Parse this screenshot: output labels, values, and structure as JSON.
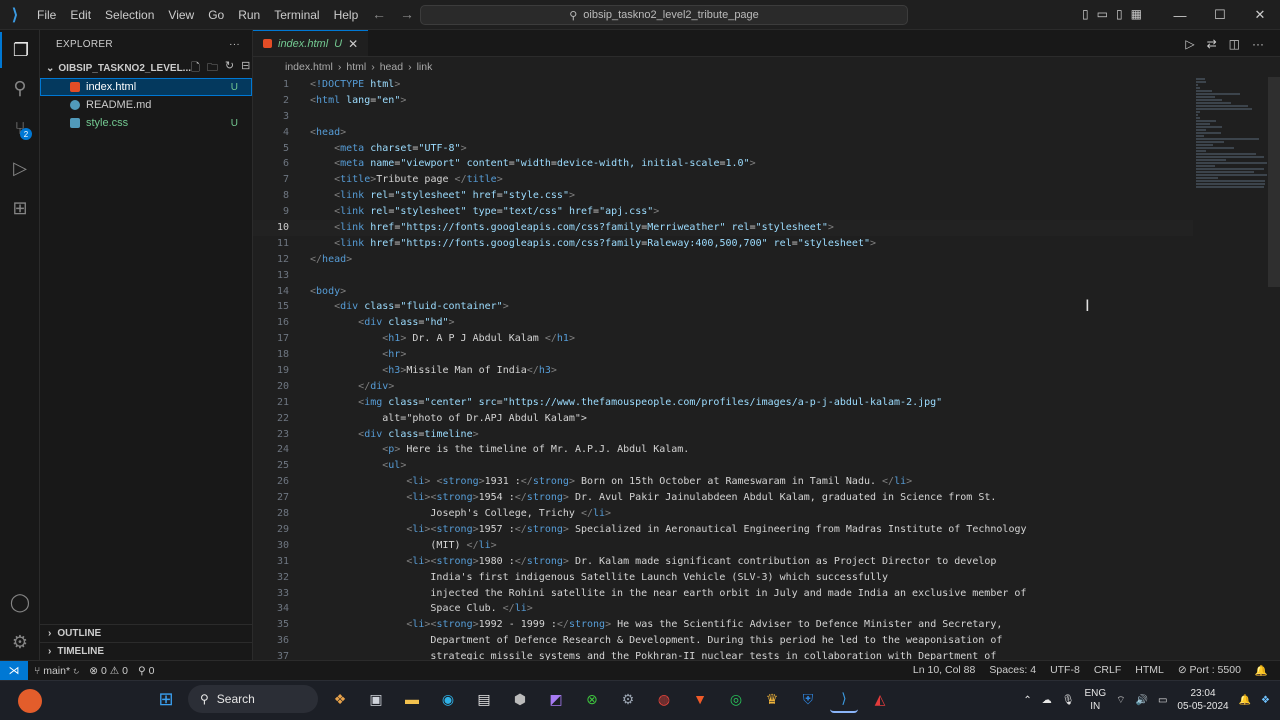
{
  "titlebar": {
    "menu": [
      "File",
      "Edit",
      "Selection",
      "View",
      "Go",
      "Run",
      "Terminal",
      "Help"
    ],
    "search_text": "oibsip_taskno2_level2_tribute_page"
  },
  "sidebar": {
    "title": "EXPLORER",
    "folder": "OIBSIP_TASKNO2_LEVEL...",
    "files": [
      {
        "name": "index.html",
        "status": "U",
        "icon_color": "#e44d26"
      },
      {
        "name": "README.md",
        "status": "",
        "icon_color": "#519aba"
      },
      {
        "name": "style.css",
        "status": "U",
        "icon_color": "#519aba"
      }
    ],
    "outline": "OUTLINE",
    "timeline": "TIMELINE"
  },
  "editor": {
    "tab_label": "index.html",
    "tab_status": "U",
    "breadcrumb": [
      "index.html",
      "html",
      "head",
      "link"
    ]
  },
  "code_lines": [
    "<!DOCTYPE html>",
    "<html lang=\"en\">",
    "",
    "<head>",
    "    <meta charset=\"UTF-8\">",
    "    <meta name=\"viewport\" content=\"width=device-width, initial-scale=1.0\">",
    "    <title>Tribute page </title>",
    "    <link rel=\"stylesheet\" href=\"style.css\">",
    "    <link rel=\"stylesheet\" type=\"text/css\" href=\"apj.css\">",
    "    <link href=\"https://fonts.googleapis.com/css?family=Merriweather\" rel=\"stylesheet\">",
    "    <link href=\"https://fonts.googleapis.com/css?family=Raleway:400,500,700\" rel=\"stylesheet\">",
    "</head>",
    "",
    "<body>",
    "    <div class=\"fluid-container\">",
    "        <div class=\"hd\">",
    "            <h1> Dr. A P J Abdul Kalam </h1>",
    "            <hr>",
    "            <h3>Missile Man of India</h3>",
    "        </div>",
    "        <img class=\"center\" src=\"https://www.thefamouspeople.com/profiles/images/a-p-j-abdul-kalam-2.jpg\"",
    "            alt=\"photo of Dr.APJ Abdul Kalam\">",
    "        <div class=timeline>",
    "            <p> Here is the timeline of Mr. A.P.J. Abdul Kalam.",
    "            <ul>",
    "                <li> <strong>1931 :</strong> Born on 15th October at Rameswaram in Tamil Nadu. </li>",
    "                <li><strong>1954 :</strong> Dr. Avul Pakir Jainulabdeen Abdul Kalam, graduated in Science from St.",
    "                    Joseph's College, Trichy </li>",
    "                <li><strong>1957 :</strong> Specialized in Aeronautical Engineering from Madras Institute of Technology",
    "                    (MIT) </li>",
    "                <li><strong>1980 :</strong> Dr. Kalam made significant contribution as Project Director to develop",
    "                    India's first indigenous Satellite Launch Vehicle (SLV-3) which successfully",
    "                    injected the Rohini satellite in the near earth orbit in July and made India an exclusive member of",
    "                    Space Club. </li>",
    "                <li><strong>1992 - 1999 :</strong> He was the Scientific Adviser to Defence Minister and Secretary,",
    "                    Department of Defence Research & Development. During this period he led to the weaponisation of",
    "                    strategic missile systems and the Pokhran-II nuclear tests in collaboration with Department of"
  ],
  "current_line": 10,
  "statusbar": {
    "branch": "main*",
    "errors": "0",
    "warnings": "0",
    "ports_count": "0",
    "position": "Ln 10, Col 88",
    "spaces": "Spaces: 4",
    "encoding": "UTF-8",
    "eol": "CRLF",
    "language": "HTML",
    "port": "Port : 5500"
  },
  "taskbar": {
    "search": "Search",
    "lang_top": "ENG",
    "lang_bottom": "IN",
    "time": "23:04",
    "date": "05-05-2024"
  },
  "colors": {
    "accent": "#0078d4",
    "untracked": "#73c991"
  }
}
